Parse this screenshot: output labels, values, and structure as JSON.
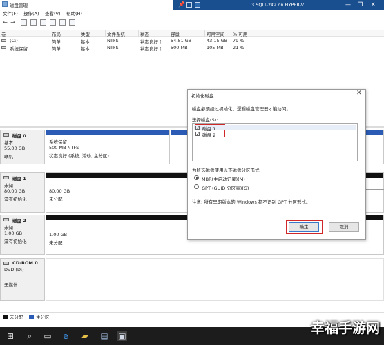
{
  "window": {
    "title": "磁盘管理"
  },
  "vm_bar": {
    "title": "3.SQLT-242 on HYPER-V",
    "pin": "📌",
    "minimize": "—",
    "restore": "❐",
    "close": "✕"
  },
  "menu": [
    "文件(F)",
    "操作(A)",
    "查看(V)",
    "帮助(H)"
  ],
  "volume_list": {
    "headers": [
      "卷",
      "布局",
      "类型",
      "文件系统",
      "状态",
      "容量",
      "可用空间",
      "% 可用"
    ],
    "rows": [
      [
        "(C:)",
        "简单",
        "基本",
        "NTFS",
        "状态良好 (...",
        "54.51 GB",
        "43.15 GB",
        "79 %"
      ],
      [
        "系统保留",
        "简单",
        "基本",
        "NTFS",
        "状态良好 (...",
        "500 MB",
        "105 MB",
        "21 %"
      ]
    ]
  },
  "disks": [
    {
      "name": "磁盘 0",
      "type": "基本",
      "size": "55.00 GB",
      "status": "联机",
      "partitions": [
        {
          "title": "系统保留",
          "line2": "500 MB NTFS",
          "line3": "状态良好 (系统, 活动, 主分区)"
        },
        {
          "title": "",
          "line2": "",
          "line3": ""
        }
      ]
    },
    {
      "name": "磁盘 1",
      "type": "未知",
      "size": "80.00 GB",
      "status": "没有初始化",
      "partitions": [
        {
          "title": "",
          "line2": "80.00 GB",
          "line3": "未分配"
        }
      ]
    },
    {
      "name": "磁盘 2",
      "type": "未知",
      "size": "1.00 GB",
      "status": "没有初始化",
      "partitions": [
        {
          "title": "",
          "line2": "1.00 GB",
          "line3": "未分配"
        }
      ]
    },
    {
      "name": "CD-ROM 0",
      "type": "DVD (D:)",
      "size": "",
      "status": "无媒体",
      "partitions": []
    }
  ],
  "legend": {
    "unallocated": "未分配",
    "primary": "主分区"
  },
  "dialog": {
    "title": "初始化磁盘",
    "close": "✕",
    "intro": "磁盘必须经过初始化，逻辑磁盘管理器才能访问。",
    "select_label": "选择磁盘(S):",
    "disk_items": [
      {
        "label": "磁盘 1",
        "checked": true
      },
      {
        "label": "磁盘 2",
        "checked": true
      }
    ],
    "partition_style_label": "为所选磁盘使用以下磁盘分区形式:",
    "mbr_label": "MBR(主启动记录)(M)",
    "gpt_label": "GPT (GUID 分区表)(G)",
    "note": "注意: 所有早期版本的 Windows 都不识别 GPT 分区形式。",
    "ok_label": "确定",
    "cancel_label": "取消"
  },
  "watermark": "幸福手游网",
  "colors": {
    "accent_blue": "#1a4f8f",
    "partition_black": "#111111",
    "primary_blue": "#2b5bb5",
    "highlight_red": "#d02828"
  },
  "icons": {
    "back": "arrow-left-icon",
    "forward": "arrow-right-icon",
    "start": "windows-icon",
    "search": "search-icon",
    "taskview": "task-view-icon",
    "edge": "edge-icon",
    "explorer": "folder-icon",
    "server": "server-manager-icon",
    "diskmgmt": "disk-management-icon"
  }
}
